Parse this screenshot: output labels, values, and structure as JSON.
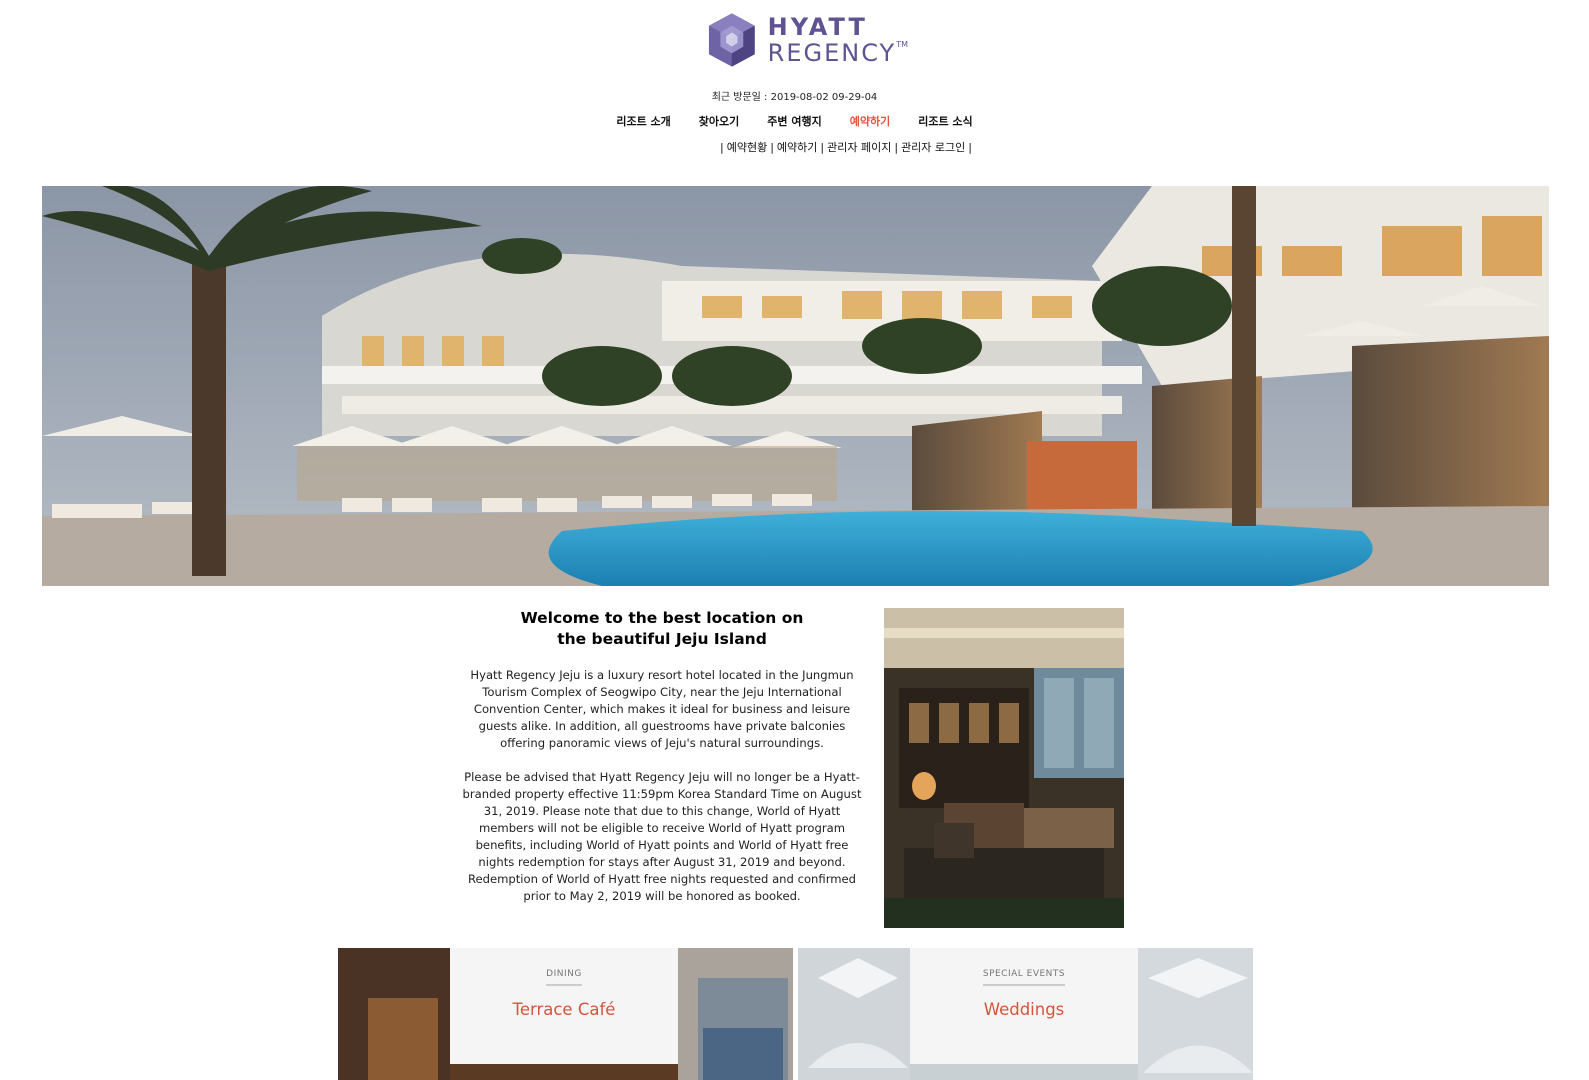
{
  "brand": {
    "line1": "HYATT",
    "line2": "REGENCY",
    "mark": "TM",
    "color": "#5f5393"
  },
  "header": {
    "last_visit": "최근 방문일 : 2019-08-02 09-29-04"
  },
  "main_nav": [
    {
      "label": "리조트 소개",
      "active": false
    },
    {
      "label": "찾아오기",
      "active": false
    },
    {
      "label": "주변 여행지",
      "active": false
    },
    {
      "label": "예약하기",
      "active": true
    },
    {
      "label": "리조트 소식",
      "active": false
    }
  ],
  "sub_nav": [
    {
      "label": "예약현황"
    },
    {
      "label": "예약하기"
    },
    {
      "label": "관리자 페이지"
    },
    {
      "label": "관리자 로그인"
    }
  ],
  "welcome": {
    "title": "Welcome to the best location on the beautiful Jeju Island",
    "para1": "Hyatt Regency Jeju is a luxury resort hotel located in the Jungmun Tourism Complex of Seogwipo City, near the Jeju International Convention Center, which makes it ideal for business and leisure guests alike. In addition, all guestrooms have private balconies offering panoramic views of Jeju's natural surroundings.",
    "para2": "Please be advised that Hyatt Regency Jeju will no longer be a Hyatt-branded property effective 11:59pm Korea Standard Time on August 31, 2019. Please note that due to this change, World of Hyatt members will not be eligible to receive World of Hyatt program benefits, including World of Hyatt points and World of Hyatt free nights redemption for stays after August 31, 2019 and beyond. Redemption of World of Hyatt free nights requested and confirmed prior to May 2, 2019 will be honored as booked."
  },
  "cards": [
    {
      "tag": "DINING",
      "title": "Terrace Café"
    },
    {
      "tag": "SPECIAL EVENTS",
      "title": "Weddings"
    }
  ],
  "colors": {
    "accent": "#e8533a",
    "card_title": "#d6543b"
  }
}
